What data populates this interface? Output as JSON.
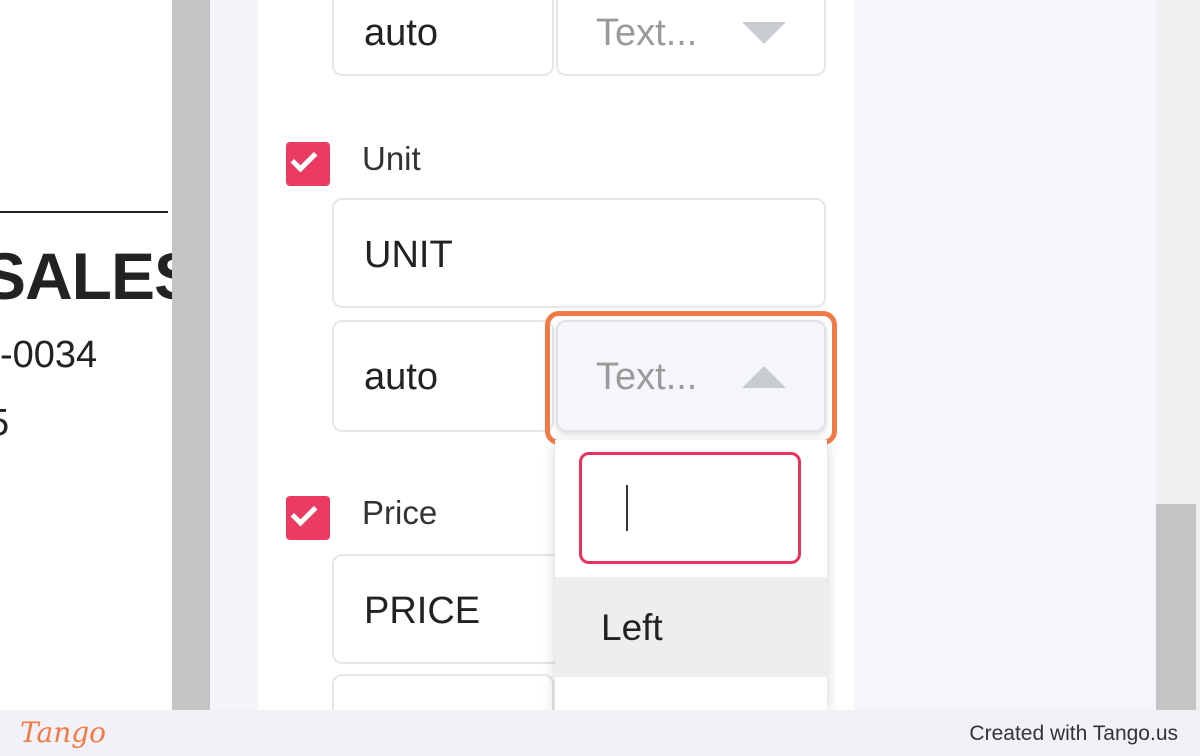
{
  "document": {
    "title_fragment": "SALES",
    "phone_fragment": "-0034",
    "digit_fragment": "5"
  },
  "fields": {
    "top": {
      "width_value": "auto",
      "align_placeholder": "Text..."
    },
    "unit": {
      "label": "Unit",
      "checked": true,
      "header_value": "UNIT",
      "width_value": "auto",
      "align_placeholder": "Text..."
    },
    "price": {
      "label": "Price",
      "checked": true,
      "header_value": "PRICE"
    }
  },
  "dropdown": {
    "search_value": "",
    "options": [
      "Left"
    ]
  },
  "footer": {
    "logo": "Tango",
    "credit": "Created with Tango.us"
  },
  "colors": {
    "checkbox": "#ec3b62",
    "highlight": "#f47a45",
    "search_border": "#e8335f"
  },
  "icons": {
    "checkbox_check": "checkmark-icon",
    "select_collapsed": "caret-down-icon",
    "select_expanded": "caret-up-icon"
  }
}
